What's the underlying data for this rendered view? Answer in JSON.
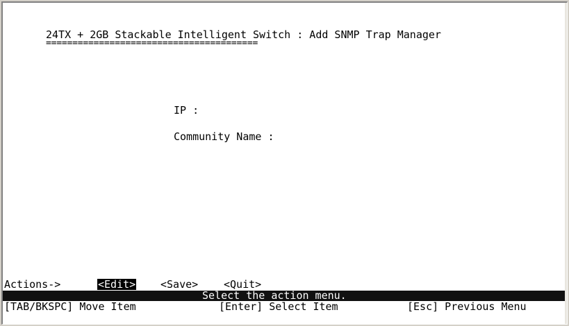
{
  "screen": {
    "title": "24TX + 2GB Stackable Intelligent Switch : Add SNMP Trap Manager",
    "title_underline": "========================================"
  },
  "form": {
    "ip_label": "IP :",
    "community_label": "Community Name :"
  },
  "actions": {
    "prefix": "Actions->",
    "edit": "<Edit>",
    "cursor": "_",
    "save": "<Save>",
    "quit": "<Quit>"
  },
  "status": {
    "message": "Select the action menu."
  },
  "help": {
    "move": "[TAB/BKSPC] Move Item",
    "select": "[Enter] Select Item",
    "back": "[Esc] Previous Menu"
  },
  "colors": {
    "background": "#ffffff",
    "text": "#000000",
    "status_bar": "#111111",
    "selected_bg": "#000000"
  }
}
